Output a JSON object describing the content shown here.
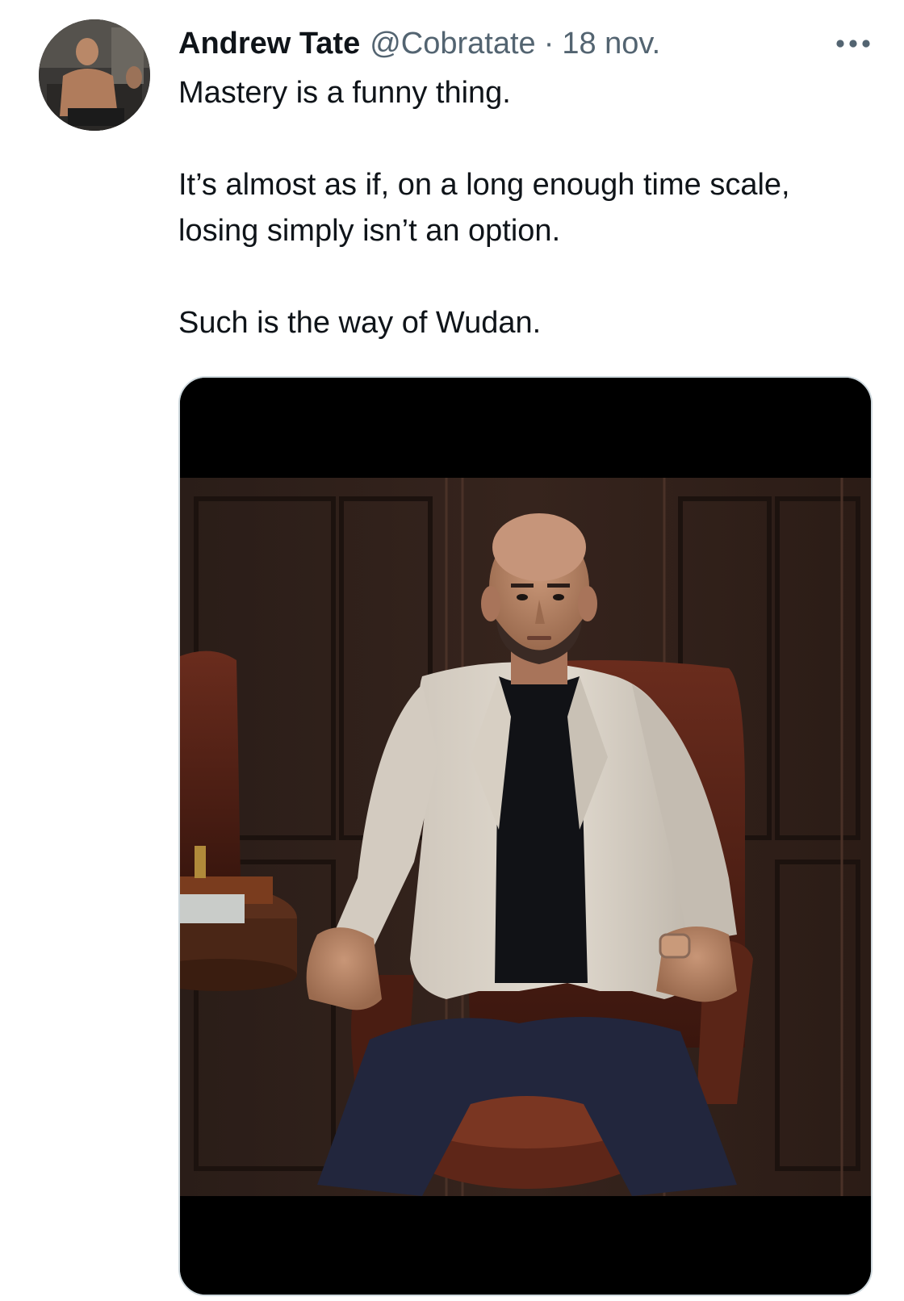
{
  "tweet": {
    "author": {
      "display_name": "Andrew Tate",
      "handle": "@Cobratate",
      "avatar_icon": "profile-photo"
    },
    "separator": "·",
    "date": "18 nov.",
    "more_icon": "more-horizontal-icon",
    "text_paragraphs": [
      "Mastery is a funny thing.",
      "It’s almost as if, on a long enough time scale, losing simply isn’t an option.",
      "Such is the way of Wudan."
    ],
    "media": {
      "kind": "photo",
      "subject": "man seated in leather armchair"
    }
  },
  "colors": {
    "text_primary": "#0f1419",
    "text_secondary": "#536471",
    "media_border": "#cfd9de",
    "letterbox": "#000000"
  }
}
